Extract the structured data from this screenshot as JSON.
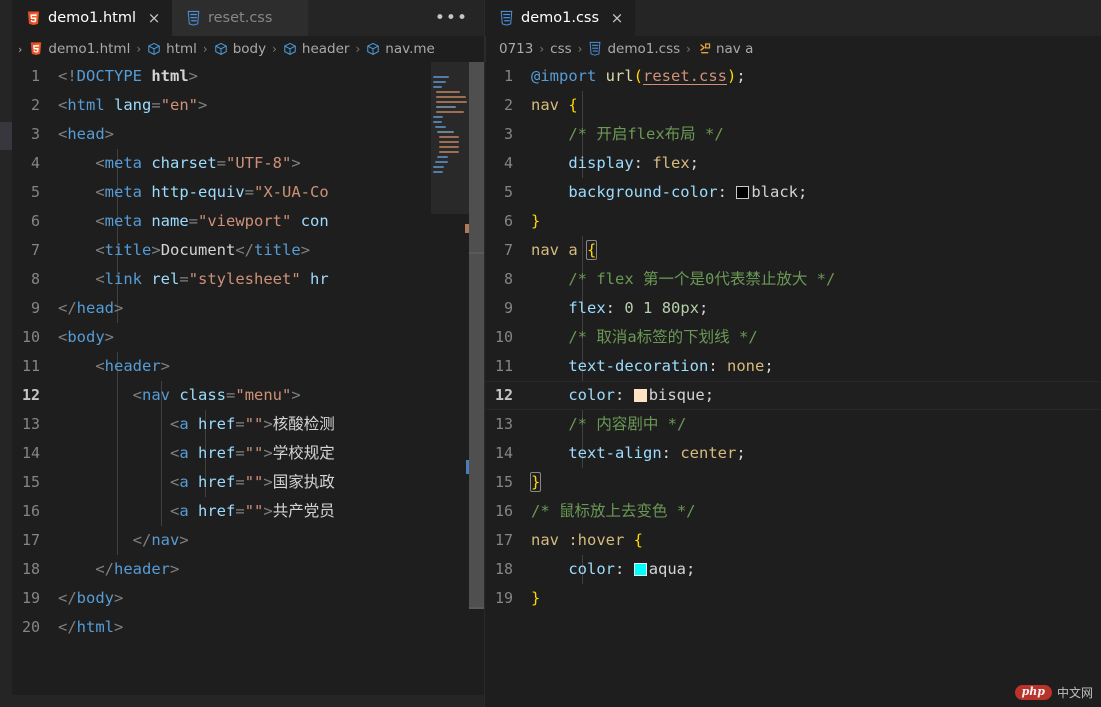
{
  "left_pane": {
    "tabs": [
      {
        "label": "demo1.html",
        "icon": "html5-icon",
        "active": true,
        "close": "×"
      },
      {
        "label": "reset.css",
        "icon": "css3-icon",
        "active": false,
        "close": "×"
      }
    ],
    "overflow_label": "•••",
    "breadcrumb": {
      "root_chevron": "›",
      "items": [
        {
          "label": "demo1.html",
          "icon": "html5-icon"
        },
        {
          "label": "html",
          "icon": "cube-icon"
        },
        {
          "label": "body",
          "icon": "cube-icon"
        },
        {
          "label": "header",
          "icon": "cube-icon"
        },
        {
          "label": "nav.me",
          "icon": "cube-icon"
        }
      ],
      "separator": "›"
    },
    "cursor_line": 12,
    "code_lines": [
      {
        "n": 1,
        "text": "<!DOCTYPE html>"
      },
      {
        "n": 2,
        "text": "<html lang=\"en\">"
      },
      {
        "n": 3,
        "text": "<head>"
      },
      {
        "n": 4,
        "text": "    <meta charset=\"UTF-8\">"
      },
      {
        "n": 5,
        "text": "    <meta http-equiv=\"X-UA-Co"
      },
      {
        "n": 6,
        "text": "    <meta name=\"viewport\" con"
      },
      {
        "n": 7,
        "text": "    <title>Document</title>"
      },
      {
        "n": 8,
        "text": "    <link rel=\"stylesheet\" hr"
      },
      {
        "n": 9,
        "text": "</head>"
      },
      {
        "n": 10,
        "text": "<body>"
      },
      {
        "n": 11,
        "text": "    <header>"
      },
      {
        "n": 12,
        "text": "        <nav class=\"menu\">"
      },
      {
        "n": 13,
        "text": "            <a href=\"\">核酸检测"
      },
      {
        "n": 14,
        "text": "            <a href=\"\">学校规定"
      },
      {
        "n": 15,
        "text": "            <a href=\"\">国家执政"
      },
      {
        "n": 16,
        "text": "            <a href=\"\">共产党员"
      },
      {
        "n": 17,
        "text": "        </nav>"
      },
      {
        "n": 18,
        "text": "    </header>"
      },
      {
        "n": 19,
        "text": "</body>"
      },
      {
        "n": 20,
        "text": "</html>"
      }
    ]
  },
  "right_pane": {
    "tabs": [
      {
        "label": "demo1.css",
        "icon": "css3-icon",
        "active": true,
        "close": "×"
      }
    ],
    "breadcrumb": {
      "items": [
        {
          "label": "0713",
          "icon": "none"
        },
        {
          "label": "css",
          "icon": "none"
        },
        {
          "label": "demo1.css",
          "icon": "css3-icon"
        },
        {
          "label": "nav a",
          "icon": "css-rule-icon"
        }
      ],
      "separator": "›"
    },
    "cursor_line": 12,
    "code_lines": [
      {
        "n": 1,
        "text": "@import url(reset.css);"
      },
      {
        "n": 2,
        "text": "nav {"
      },
      {
        "n": 3,
        "text": "    /* 开启flex布局 */"
      },
      {
        "n": 4,
        "text": "    display: flex;"
      },
      {
        "n": 5,
        "text": "    background-color: black;"
      },
      {
        "n": 6,
        "text": "}"
      },
      {
        "n": 7,
        "text": "nav a {"
      },
      {
        "n": 8,
        "text": "    /* flex 第一个是0代表禁止放大 */"
      },
      {
        "n": 9,
        "text": "    flex: 0 1 80px;"
      },
      {
        "n": 10,
        "text": "    /* 取消a标签的下划线 */"
      },
      {
        "n": 11,
        "text": "    text-decoration: none;"
      },
      {
        "n": 12,
        "text": "    color: bisque;"
      },
      {
        "n": 13,
        "text": "    /* 内容剧中 */"
      },
      {
        "n": 14,
        "text": "    text-align: center;"
      },
      {
        "n": 15,
        "text": "}"
      },
      {
        "n": 16,
        "text": "/* 鼠标放上去变色 */"
      },
      {
        "n": 17,
        "text": "nav :hover {"
      },
      {
        "n": 18,
        "text": "    color: aqua;"
      },
      {
        "n": 19,
        "text": "}"
      }
    ],
    "color_swatches": {
      "black": "#000000",
      "bisque": "#ffe4c4",
      "aqua": "#00ffff"
    }
  },
  "watermark": {
    "badge": "php",
    "text": "中文网"
  },
  "theme": {
    "editor_bg": "#1e1e1e",
    "tabbar_bg": "#252526",
    "tab_inactive_bg": "#2d2d2d",
    "line_number": "#858585",
    "accent_html": "#e44d26",
    "accent_css": "#2f7ecb",
    "accent_rule": "#e8a33d"
  }
}
